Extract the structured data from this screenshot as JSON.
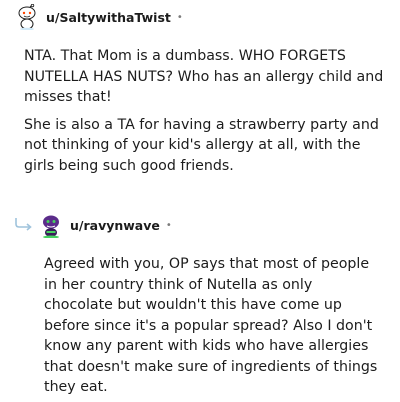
{
  "comment1": {
    "username": "u/SaltywithaTwist",
    "separator": "•",
    "avatar_icon": "snoo-avatar-icon",
    "paragraphs": [
      "NTA. That Mom is a dumbass. WHO FORGETS NUTELLA HAS NUTS? Who has an allergy child and misses that!",
      "She is also a TA for having a strawberry party and not thinking of your kid's allergy at all, with the girls being such good friends."
    ]
  },
  "comment2": {
    "username": "u/ravynwave",
    "separator": "•",
    "avatar_icon": "snoo-avatar-icon",
    "reply_icon": "reply-arrow-icon",
    "paragraphs": [
      "Agreed with you, OP says that most of people in her country think of Nutella as only chocolate but wouldn't this have come up before since it's a popular spread? Also I don't know any parent with kids who have allergies that doesn't make sure of ingredients of things they eat."
    ]
  },
  "colors": {
    "accent": "#46d160",
    "muted": "#7c7c7c",
    "text": "#1c1c1c"
  }
}
